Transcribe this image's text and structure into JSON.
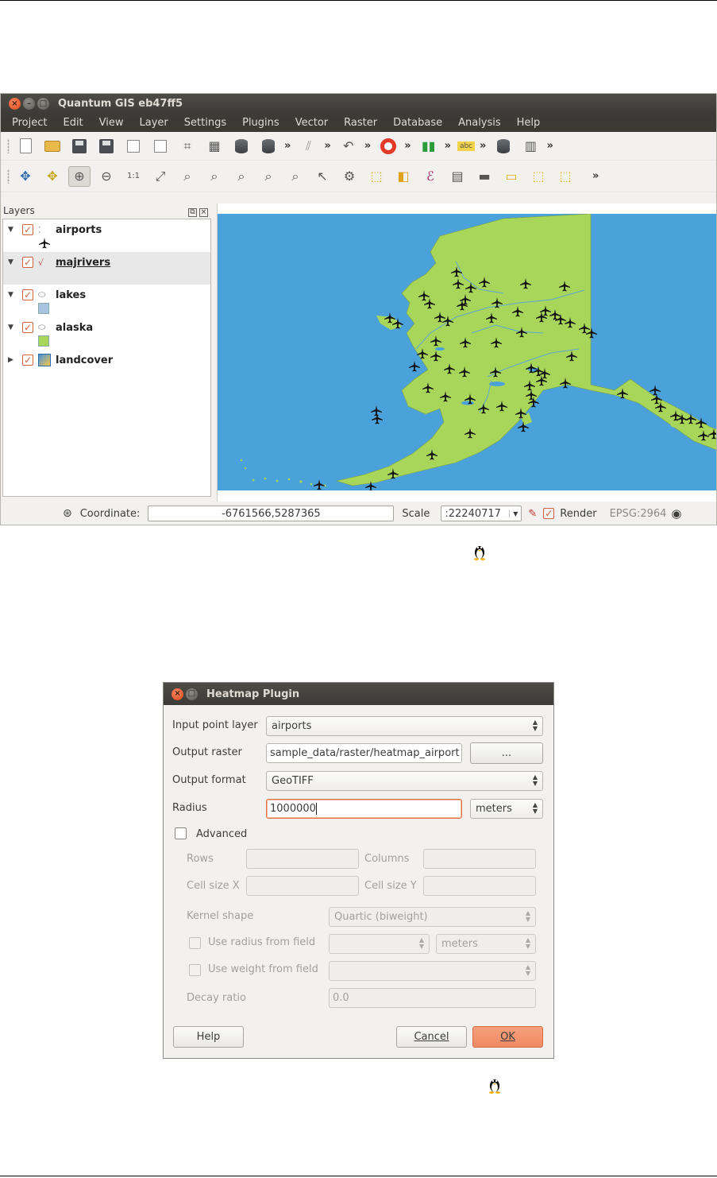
{
  "qgis": {
    "window_title": "Quantum GIS eb47ff5",
    "menu": [
      "Project",
      "Edit",
      "View",
      "Layer",
      "Settings",
      "Plugins",
      "Vector",
      "Raster",
      "Database",
      "Analysis",
      "Help"
    ],
    "layers_panel_title": "Layers",
    "layers": [
      {
        "name": "airports",
        "type": "point",
        "checked": true,
        "expanded": true,
        "symbol": "airplane-icon"
      },
      {
        "name": "majrivers",
        "type": "line",
        "checked": true,
        "expanded": true,
        "selected": true
      },
      {
        "name": "lakes",
        "type": "polygon",
        "checked": true,
        "expanded": true,
        "fill": "#a8c4e0"
      },
      {
        "name": "alaska",
        "type": "polygon",
        "checked": true,
        "expanded": true,
        "fill": "#a8d65a"
      },
      {
        "name": "landcover",
        "type": "raster",
        "checked": true,
        "expanded": false
      }
    ],
    "status": {
      "coordinate_label": "Coordinate:",
      "coordinate_value": "-6761566,5287365",
      "scale_label": "Scale",
      "scale_value": ":22240717",
      "render_label": "Render",
      "crs": "EPSG:2964"
    },
    "colors": {
      "water": "#4ba2db",
      "land": "#a8d65a",
      "accent": "#e1723f"
    }
  },
  "heatmap": {
    "title": "Heatmap Plugin",
    "input_layer_label": "Input point layer",
    "input_layer_value": "airports",
    "output_raster_label": "Output raster",
    "output_raster_value": "sample_data/raster/heatmap_airport",
    "browse_label": "...",
    "output_format_label": "Output format",
    "output_format_value": "GeoTIFF",
    "radius_label": "Radius",
    "radius_value": "1000000",
    "radius_unit": "meters",
    "advanced_label": "Advanced",
    "rows_label": "Rows",
    "columns_label": "Columns",
    "cell_x_label": "Cell size X",
    "cell_y_label": "Cell size Y",
    "kernel_label": "Kernel shape",
    "kernel_value": "Quartic (biweight)",
    "radius_field_label": "Use radius from field",
    "radius_field_unit": "meters",
    "weight_field_label": "Use weight from field",
    "decay_label": "Decay ratio",
    "decay_value": "0.0",
    "help_label": "Help",
    "cancel_label": "Cancel",
    "ok_label": "OK"
  }
}
